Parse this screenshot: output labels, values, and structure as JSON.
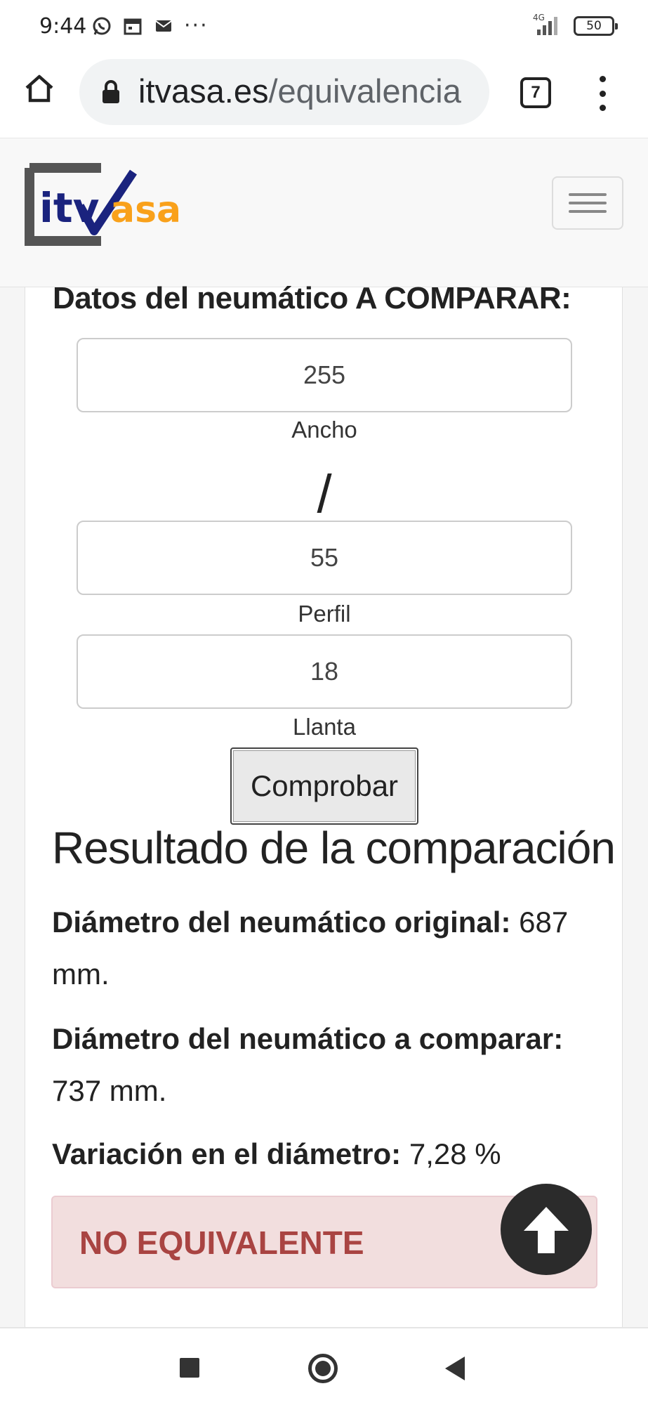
{
  "status_bar": {
    "time": "9:44",
    "network": "4G",
    "battery": "50",
    "icons": [
      "whatsapp-icon",
      "calendar-icon",
      "mail-icon",
      "more-dots-icon",
      "signal-icon",
      "battery-icon"
    ]
  },
  "browser": {
    "url_domain": "itvasa.es",
    "url_path": "/equivalencia",
    "tab_count": "7"
  },
  "header": {
    "logo_text_it": "itv",
    "logo_text_asa": "asa"
  },
  "form": {
    "section_title": "Datos del neumático A COMPARAR:",
    "width_value": "255",
    "width_label": "Ancho",
    "separator": "/",
    "profile_value": "55",
    "profile_label": "Perfil",
    "rim_value": "18",
    "rim_label": "Llanta",
    "submit_label": "Comprobar"
  },
  "results": {
    "heading": "Resultado de la comparación",
    "original_label": "Diámetro del neumático original:",
    "original_value": "687 mm.",
    "compare_label": "Diámetro del neumático a comparar:",
    "compare_value": "737 mm.",
    "variation_label": "Variación en el diámetro:",
    "variation_value": "7,28 %",
    "verdict": "NO EQUIVALENTE"
  },
  "colors": {
    "logo_blue": "#1a237e",
    "logo_orange": "#f9a11b",
    "logo_frame": "#555555",
    "alert_bg": "#f2dede",
    "alert_text": "#a94442"
  }
}
